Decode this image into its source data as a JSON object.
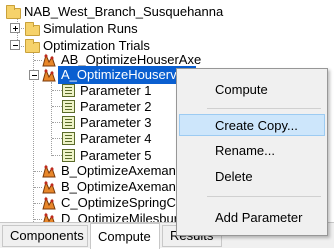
{
  "tree": {
    "root": "NAB_West_Branch_Susquehanna",
    "simulation_runs": "Simulation Runs",
    "optimization_trials": "Optimization Trials",
    "trials": [
      "AB_OptimizeHouserAxe",
      "A_OptimizeHouserville",
      "B_OptimizeAxemann",
      "B_OptimizeAxemann",
      "C_OptimizeSpringCreek",
      "D_OptimizeMilesburg"
    ],
    "parameters": [
      "Parameter 1",
      "Parameter 2",
      "Parameter 3",
      "Parameter 4",
      "Parameter 5"
    ]
  },
  "context_menu": {
    "compute": "Compute",
    "create_copy": "Create Copy...",
    "rename": "Rename...",
    "delete": "Delete",
    "add_parameter": "Add Parameter"
  },
  "tabs": {
    "components": "Components",
    "compute": "Compute",
    "results": "Results"
  },
  "colors": {
    "selection": "#0a5fd0",
    "menu_highlight": "#cde6fb",
    "menu_background": "#f0f0f0"
  },
  "icons": {
    "root": "folder-icon",
    "folders": "folder-icon",
    "trial": "optimization-trial-icon",
    "parameter": "parameter-icon"
  }
}
